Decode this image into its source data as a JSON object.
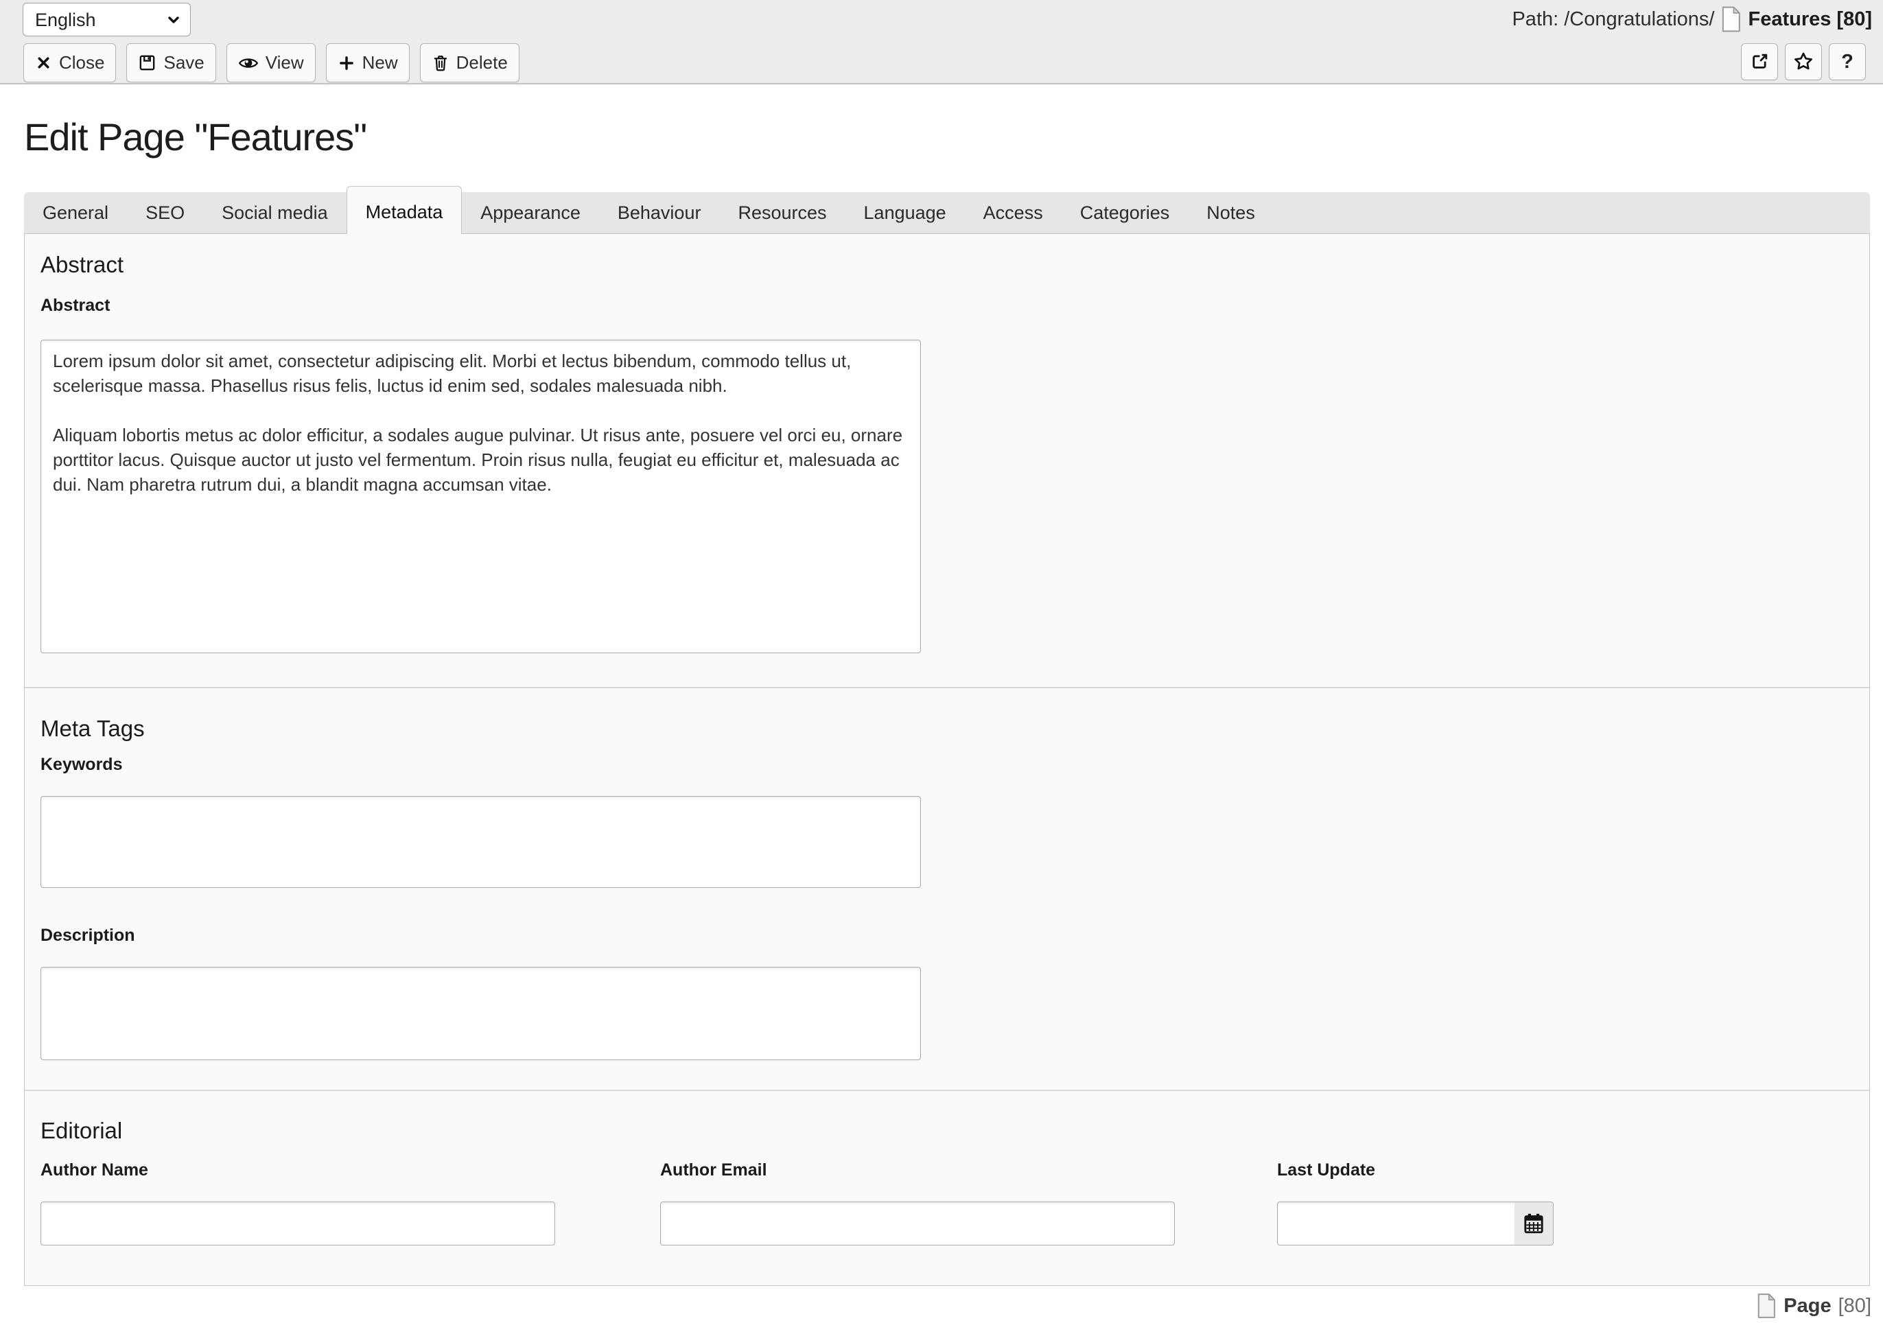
{
  "colors": {
    "docheader_bg": "#ededed",
    "panel_bg": "#fafafa",
    "tabbar_bg": "#e6e6e6",
    "border": "#c5c5c5",
    "text": "#333333"
  },
  "header": {
    "language": {
      "selected": "English"
    },
    "path_prefix": "Path: /Congratulations/",
    "record": "Features [80]"
  },
  "toolbar": {
    "close": "Close",
    "save": "Save",
    "view": "View",
    "new": "New",
    "delete": "Delete",
    "help": "?"
  },
  "page_title": "Edit Page \"Features\"",
  "tabs": [
    {
      "label": "General",
      "active": false
    },
    {
      "label": "SEO",
      "active": false
    },
    {
      "label": "Social media",
      "active": false
    },
    {
      "label": "Metadata",
      "active": true
    },
    {
      "label": "Appearance",
      "active": false
    },
    {
      "label": "Behaviour",
      "active": false
    },
    {
      "label": "Resources",
      "active": false
    },
    {
      "label": "Language",
      "active": false
    },
    {
      "label": "Access",
      "active": false
    },
    {
      "label": "Categories",
      "active": false
    },
    {
      "label": "Notes",
      "active": false
    }
  ],
  "sections": {
    "abstract": {
      "heading": "Abstract",
      "abstract_label": "Abstract",
      "abstract_value": "Lorem ipsum dolor sit amet, consectetur adipiscing elit. Morbi et lectus bibendum, commodo tellus ut, scelerisque massa. Phasellus risus felis, luctus id enim sed, sodales malesuada nibh.\n\nAliquam lobortis metus ac dolor efficitur, a sodales augue pulvinar. Ut risus ante, posuere vel orci eu, ornare porttitor lacus. Quisque auctor ut justo vel fermentum. Proin risus nulla, feugiat eu efficitur et, malesuada ac dui. Nam pharetra rutrum dui, a blandit magna accumsan vitae."
    },
    "meta_tags": {
      "heading": "Meta Tags",
      "keywords_label": "Keywords",
      "keywords_value": "",
      "description_label": "Description",
      "description_value": ""
    },
    "editorial": {
      "heading": "Editorial",
      "author_name_label": "Author Name",
      "author_name_value": "",
      "author_email_label": "Author Email",
      "author_email_value": "",
      "last_update_label": "Last Update",
      "last_update_value": ""
    }
  },
  "footer": {
    "record_type": "Page",
    "record_uid": "[80]"
  }
}
